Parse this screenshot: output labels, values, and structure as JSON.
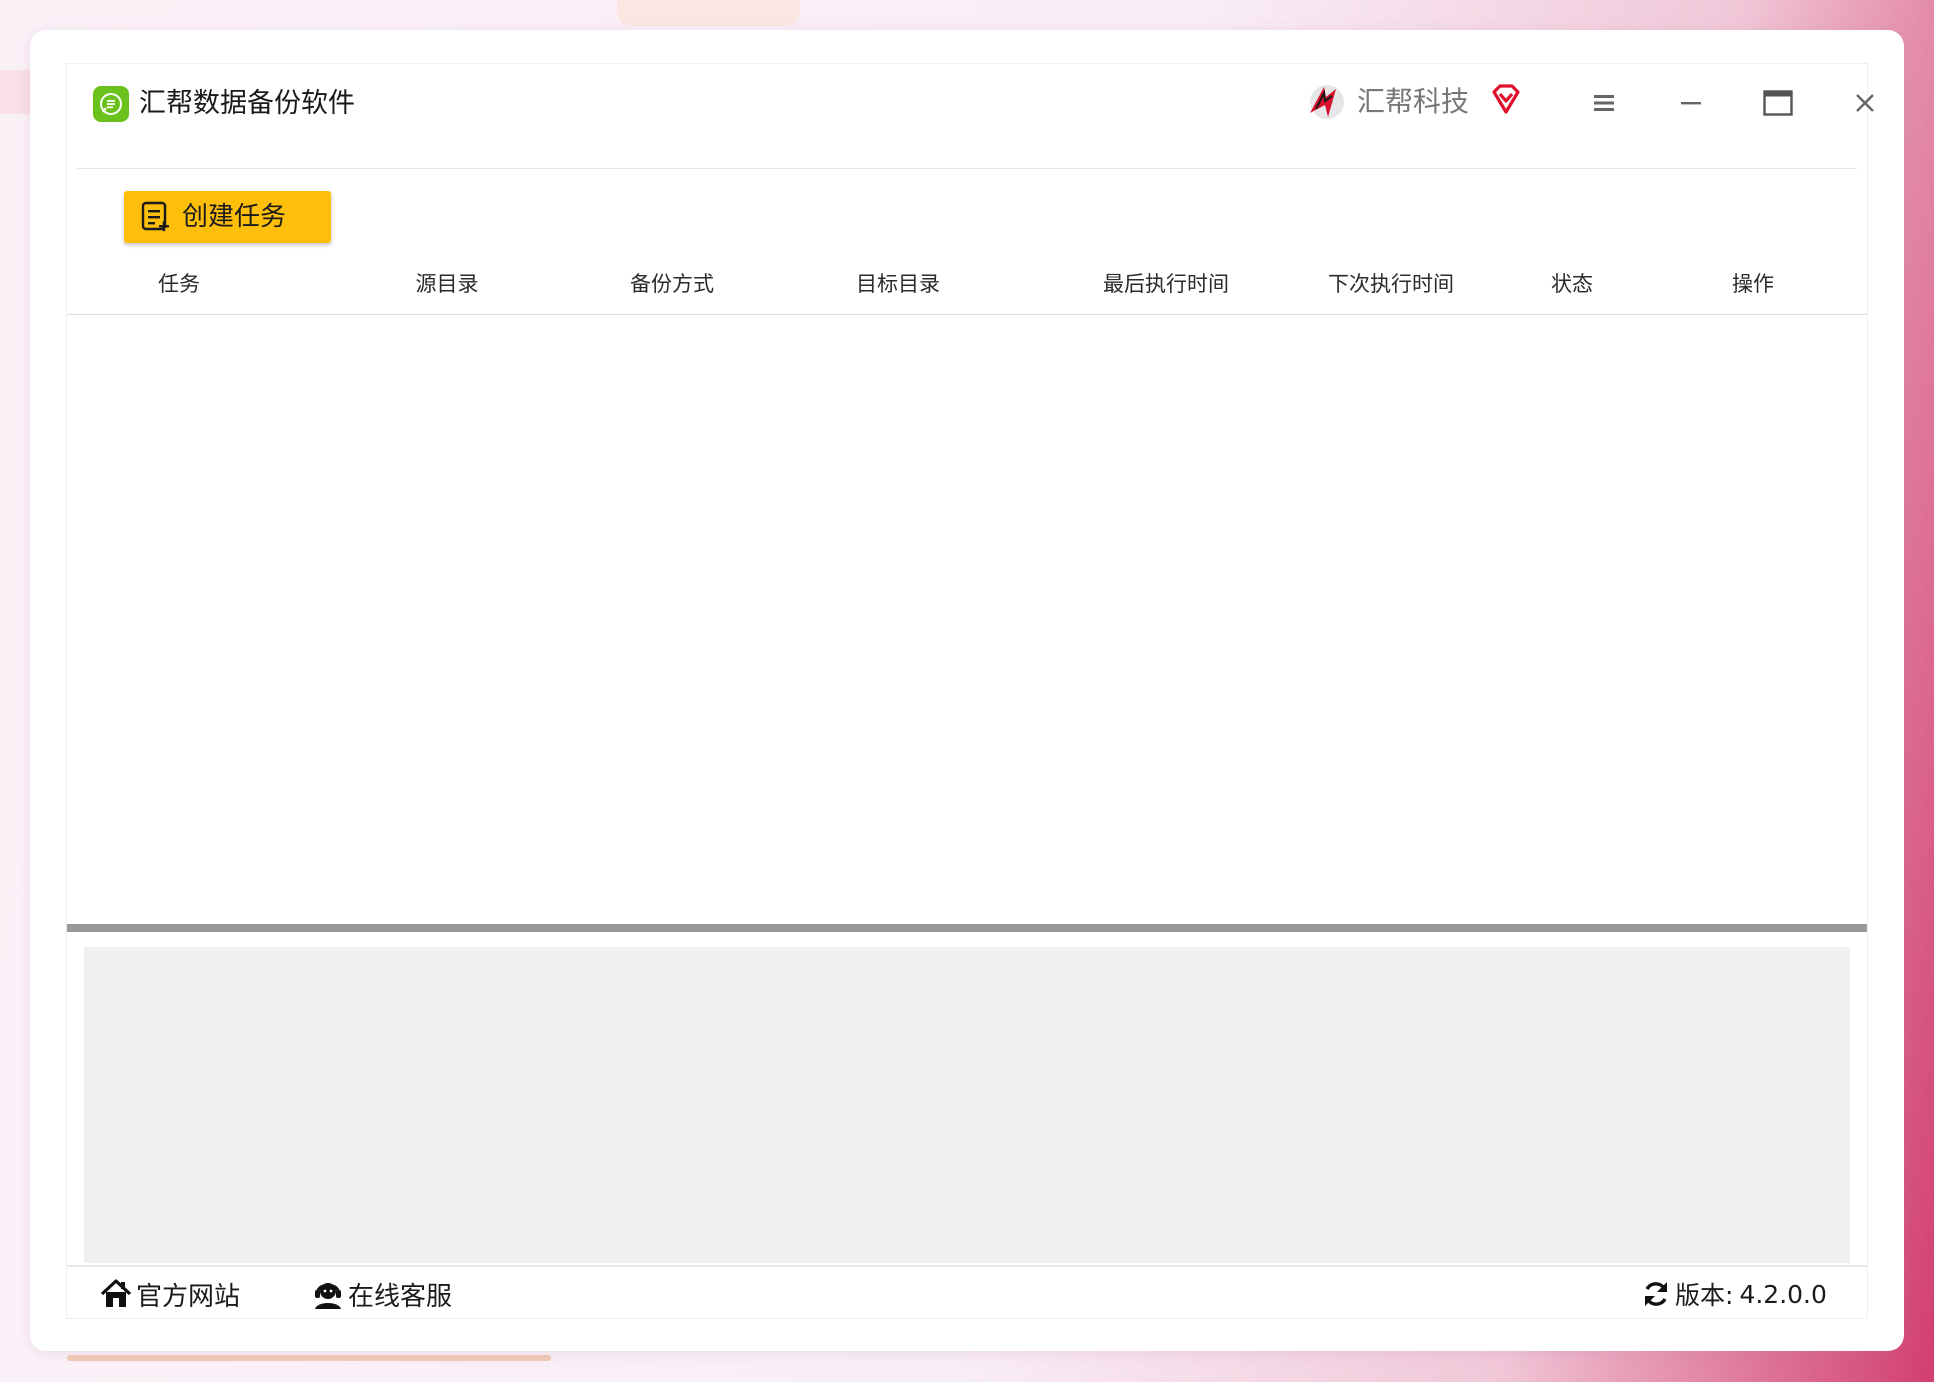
{
  "app": {
    "title": "汇帮数据备份软件",
    "brand_name": "汇帮科技",
    "accent_color": "#fdbf0a",
    "icon_color": "#6cc21c"
  },
  "window_controls": {
    "menu_icon": "hamburger-icon",
    "minimize_icon": "minimize-icon",
    "maximize_icon": "maximize-icon",
    "close_icon": "close-icon"
  },
  "toolbar": {
    "create_task_label": "创建任务"
  },
  "table": {
    "columns": [
      "任务",
      "源目录",
      "备份方式",
      "目标目录",
      "最后执行时间",
      "下次执行时间",
      "状态",
      "操作"
    ],
    "rows": []
  },
  "footer": {
    "website_label": "官方网站",
    "support_label": "在线客服",
    "version_label": "版本:",
    "version_value": "4.2.0.0"
  }
}
